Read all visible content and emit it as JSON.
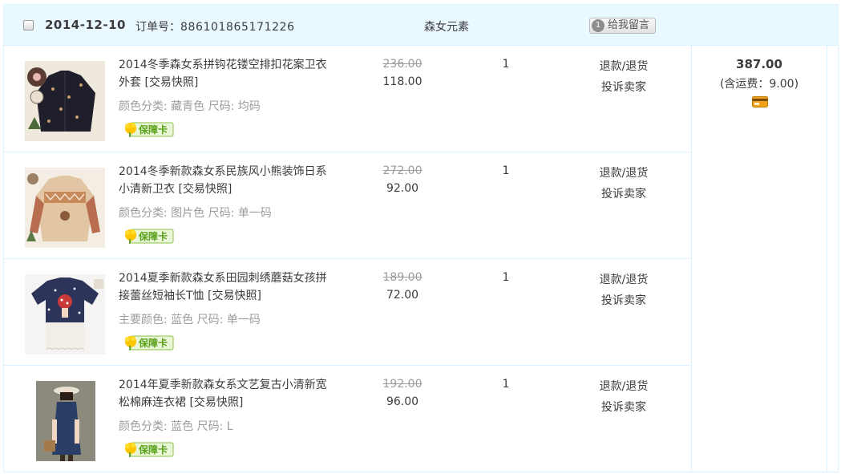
{
  "order": {
    "date": "2014-12-10",
    "order_no_label": "订单号：",
    "order_no": "886101865171226",
    "shop_name": "森女元素",
    "message_button": "给我留言",
    "message_icon": "chat-bubble-icon",
    "total": "387.00",
    "shipping_note": "(含运费：9.00)"
  },
  "items": [
    {
      "title": "2014冬季森女系拼钩花镂空排扣花案卫衣外套",
      "snapshot": "[交易快照]",
      "attrs": "颜色分类: 藏青色  尺码: 均码",
      "orig_price": "236.00",
      "price": "118.00",
      "qty": "1",
      "refund": "退款/退货",
      "complain": "投诉卖家"
    },
    {
      "title": "2014冬季新款森女系民族风小熊装饰日系小清新卫衣",
      "snapshot": "[交易快照]",
      "attrs": "颜色分类: 图片色  尺码: 单一码",
      "orig_price": "272.00",
      "price": "92.00",
      "qty": "1",
      "refund": "退款/退货",
      "complain": "投诉卖家"
    },
    {
      "title": "2014夏季新款森女系田园刺绣蘑菇女孩拼接蕾丝短袖长T恤",
      "snapshot": "[交易快照]",
      "attrs": "主要颜色: 蓝色  尺码: 单一码",
      "orig_price": "189.00",
      "price": "72.00",
      "qty": "1",
      "refund": "退款/退货",
      "complain": "投诉卖家"
    },
    {
      "title": "2014年夏季新款森女系文艺复古小清新宽松棉麻连衣裙",
      "snapshot": "[交易快照]",
      "attrs": "颜色分类: 蓝色  尺码: L",
      "orig_price": "192.00",
      "price": "96.00",
      "qty": "1",
      "refund": "退款/退货",
      "complain": "投诉卖家"
    }
  ],
  "badge_text": "保障卡",
  "colors": {
    "header_bg": "#eaf8ff",
    "border": "#daf3ff",
    "badge_green": "#5aa11a"
  }
}
